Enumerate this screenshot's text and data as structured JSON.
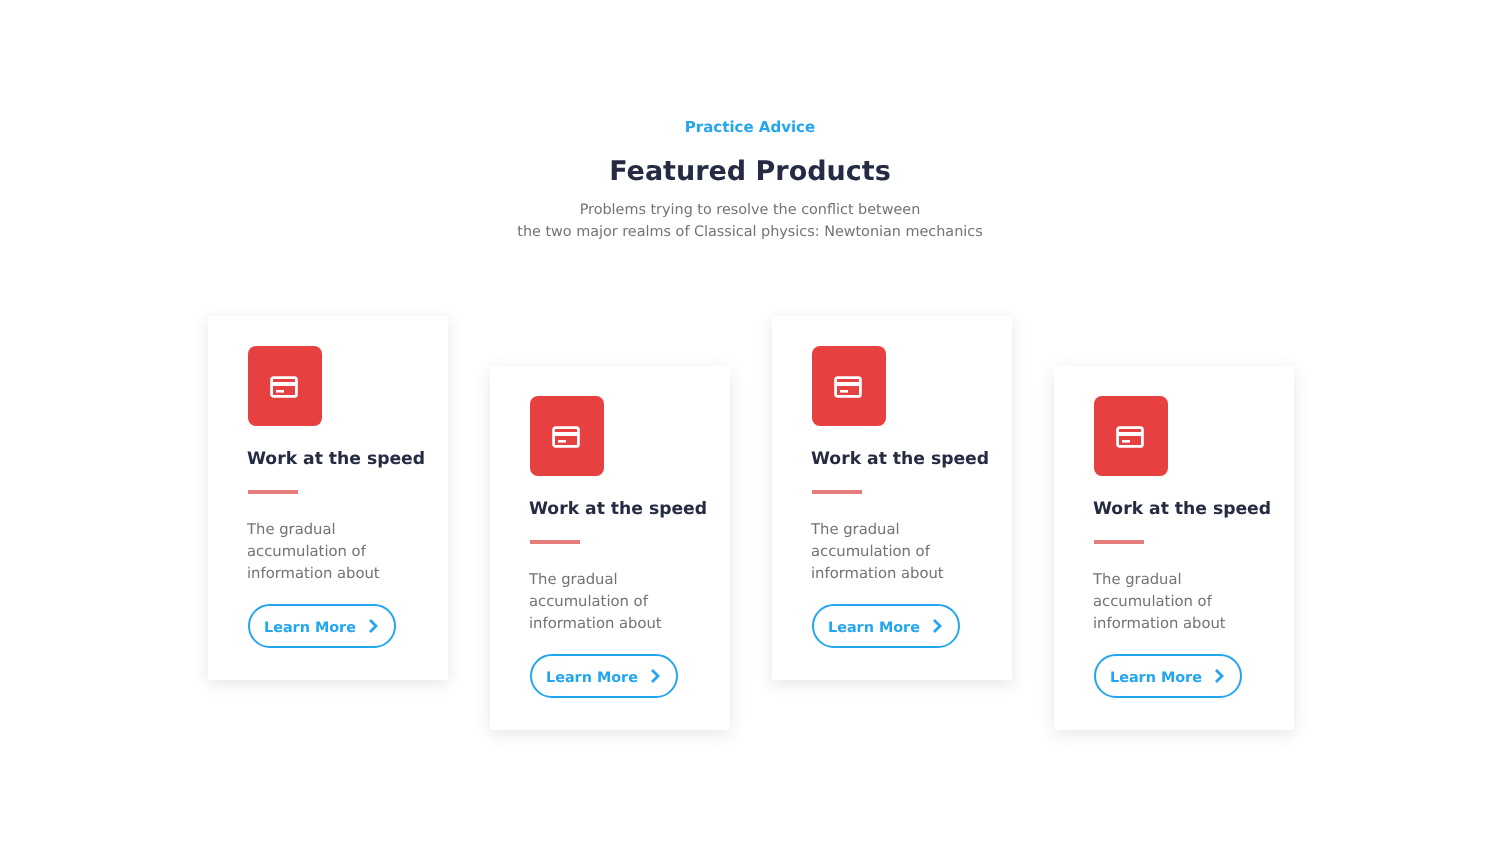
{
  "header": {
    "eyebrow": "Practice Advice",
    "title": "Featured Products",
    "subtitle_lines": [
      "Problems trying to resolve the conflict between",
      "the two major realms of Classical physics: Newtonian mechanics"
    ]
  },
  "cards": [
    {
      "title": "Work at the speed",
      "description": "The gradual accumulation of information about",
      "button": "Learn More"
    },
    {
      "title": "Work at the speed",
      "description": "The gradual accumulation of information about",
      "button": "Learn More"
    },
    {
      "title": "Work at the speed",
      "description": "The gradual accumulation of information about",
      "button": "Learn More"
    },
    {
      "title": "Work at the speed",
      "description": "The gradual accumulation of information about",
      "button": "Learn More"
    }
  ]
}
